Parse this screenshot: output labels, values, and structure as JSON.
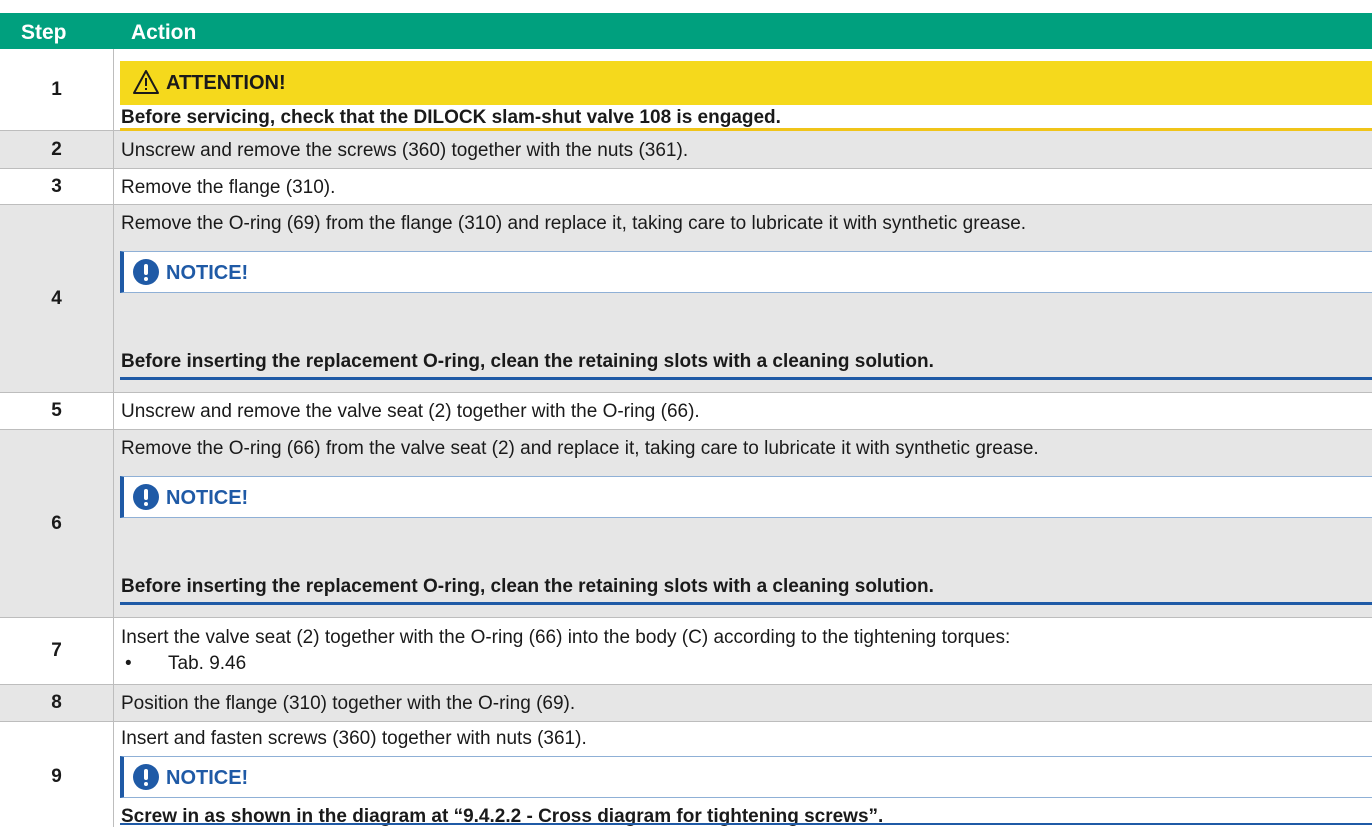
{
  "header": {
    "step": "Step",
    "action": "Action"
  },
  "rows": {
    "r1": {
      "num": "1",
      "title": "ATTENTION!",
      "text": "Before servicing, check that the DILOCK slam-shut valve 108 is engaged."
    },
    "r2": {
      "num": "2",
      "text": "Unscrew and remove the screws (360) together with the nuts (361)."
    },
    "r3": {
      "num": "3",
      "text": "Remove the flange (310)."
    },
    "r4": {
      "num": "4",
      "text": "Remove the O-ring (69) from the flange (310) and replace it, taking care to lubricate it with synthetic grease.",
      "notice_title": "NOTICE!",
      "notice_text": "Before inserting the replacement O-ring, clean the retaining slots with a cleaning solution."
    },
    "r5": {
      "num": "5",
      "text": "Unscrew and remove the valve seat (2) together with the O-ring (66)."
    },
    "r6": {
      "num": "6",
      "text": "Remove the O-ring (66) from the valve seat (2) and replace it, taking care to lubricate it with synthetic grease.",
      "notice_title": "NOTICE!",
      "notice_text": "Before inserting the replacement O-ring, clean the retaining slots with a cleaning solution."
    },
    "r7": {
      "num": "7",
      "text": "Insert the valve seat (2) together with the O-ring (66) into the body (C) according to the tightening torques:",
      "bullet": "•",
      "bullet_text": "Tab. 9.46"
    },
    "r8": {
      "num": "8",
      "text": "Position the flange (310) together with the O-ring (69)."
    },
    "r9": {
      "num": "9",
      "text": "Insert and fasten screws (360) together with nuts (361).",
      "notice_title": "NOTICE!",
      "notice_text": "Screw in as shown in the diagram at “9.4.2.2 - Cross diagram for tightening screws”."
    }
  },
  "colors": {
    "header": "#00a07e",
    "attention": "#f5d91c",
    "notice": "#1f5aa6",
    "grey_row": "#e6e6e6"
  },
  "icons": {
    "attention": "warning-triangle-icon",
    "notice": "exclamation-circle-icon"
  }
}
